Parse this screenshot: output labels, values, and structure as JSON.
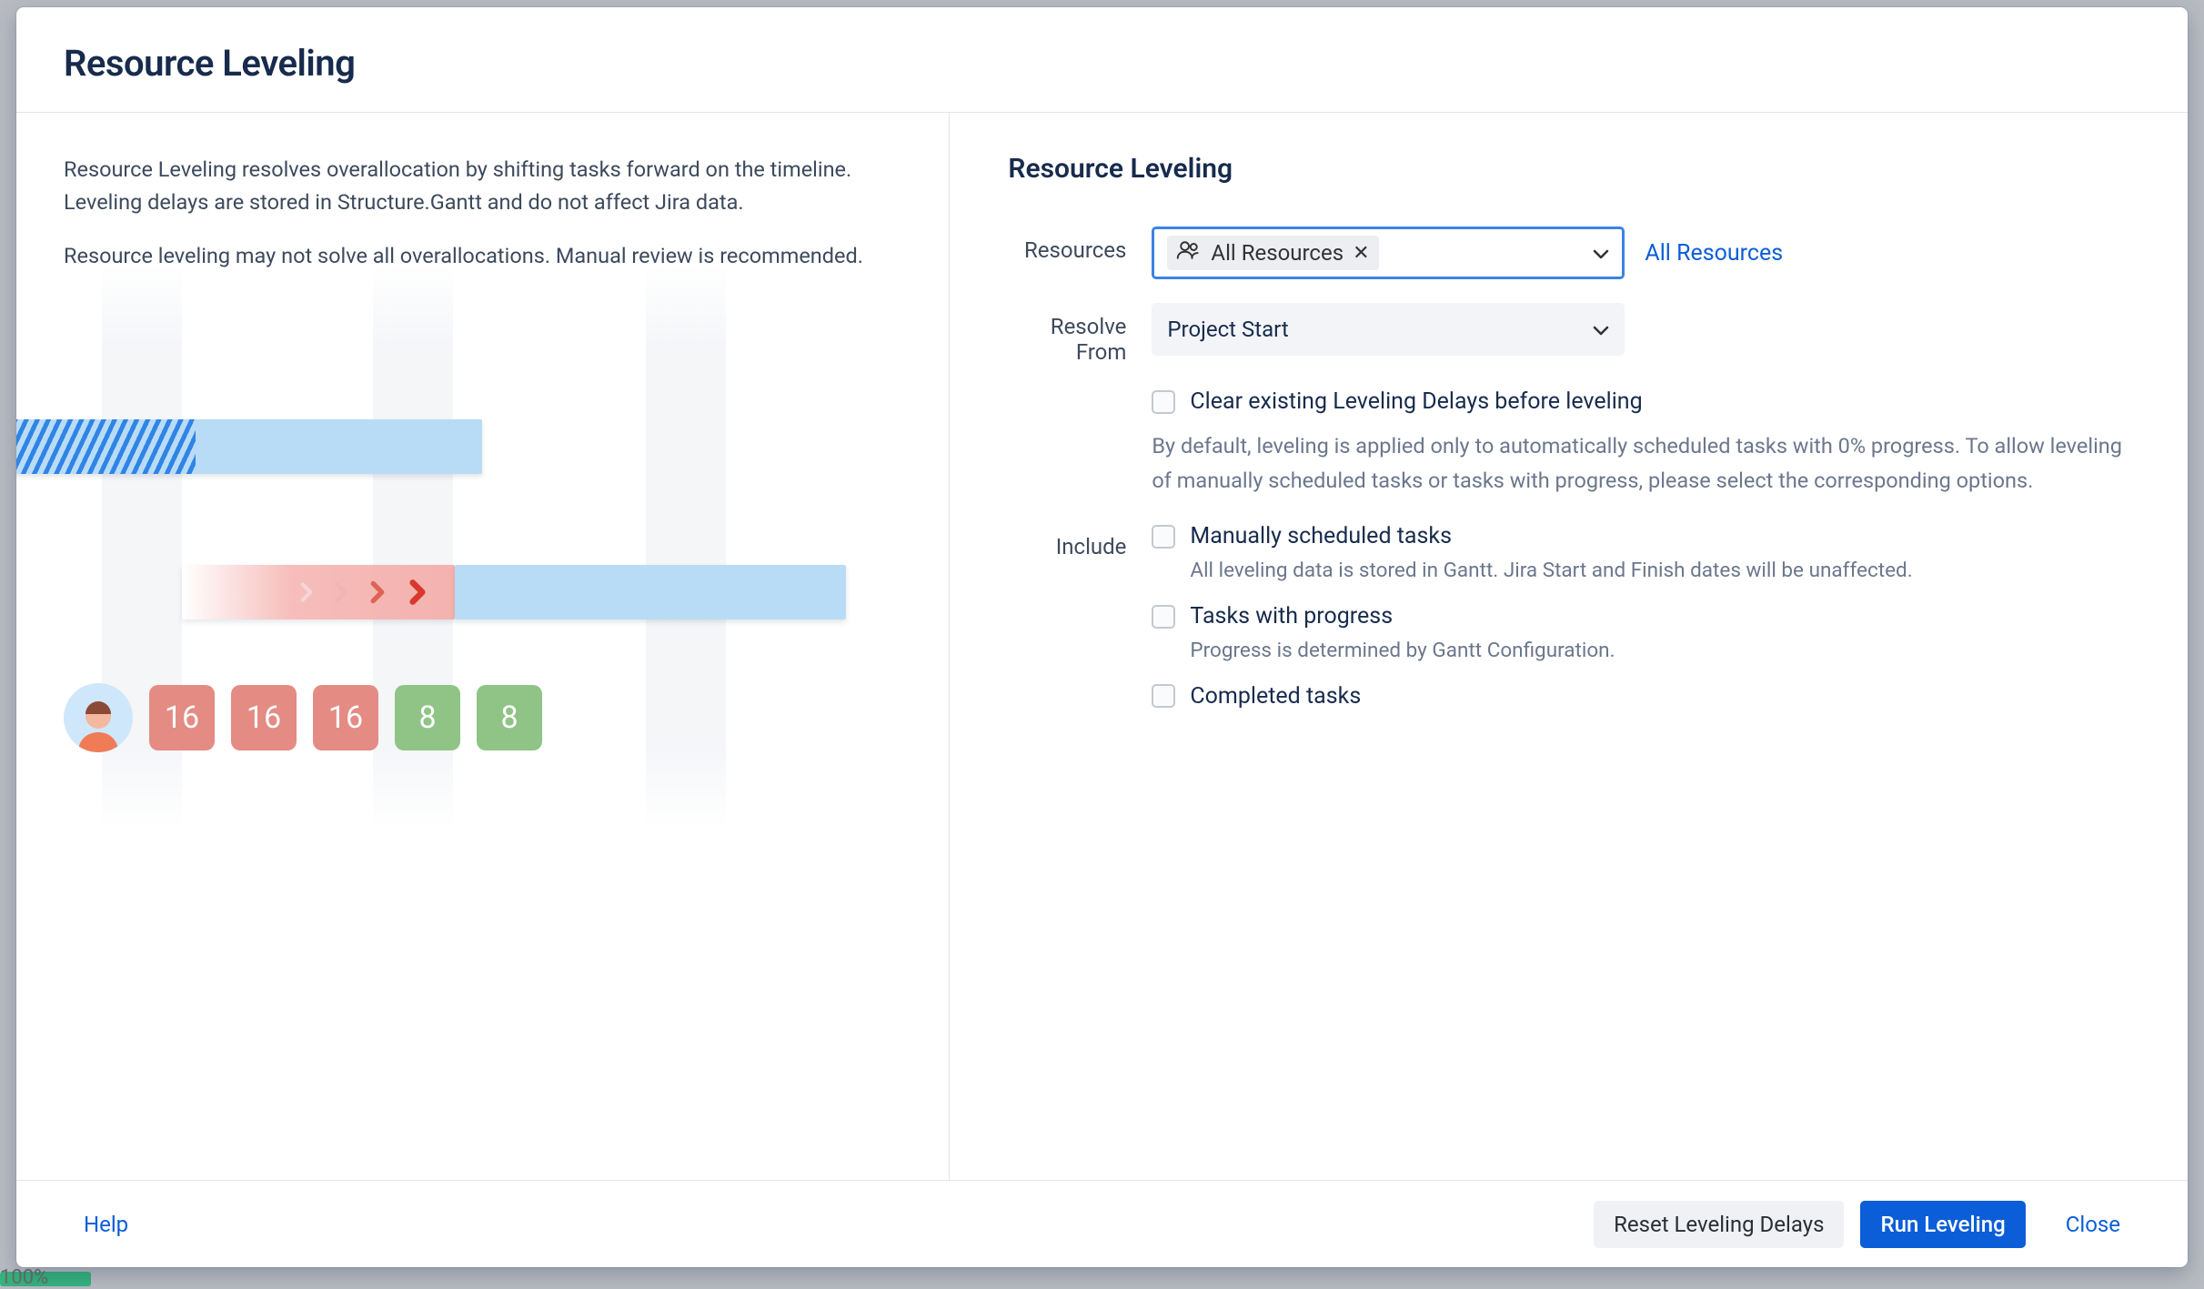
{
  "dialog": {
    "title": "Resource Leveling",
    "intro_p1": "Resource Leveling resolves overallocation by shifting tasks forward on the timeline. Leveling delays are stored in Structure.Gantt and do not affect Jira data.",
    "intro_p2": "Resource leveling may not solve all overallocations. Manual review is recommended."
  },
  "illustration": {
    "chips": [
      "16",
      "16",
      "16",
      "8",
      "8"
    ]
  },
  "form": {
    "heading": "Resource Leveling",
    "resources": {
      "label": "Resources",
      "tag_text": "All Resources",
      "all_link": "All Resources"
    },
    "resolve_from": {
      "label": "Resolve From",
      "value": "Project Start"
    },
    "clear_delays": {
      "label": "Clear existing Leveling Delays before leveling"
    },
    "default_note": "By default, leveling is applied only to automatically scheduled tasks with 0% progress. To allow leveling of manually scheduled tasks or tasks with progress, please select the corresponding options.",
    "include": {
      "label": "Include",
      "opt_manual": {
        "label": "Manually scheduled tasks",
        "help": "All leveling data is stored in Gantt. Jira Start and Finish dates will be unaffected."
      },
      "opt_progress": {
        "label": "Tasks with progress",
        "help": "Progress is determined by Gantt Configuration."
      },
      "opt_completed": {
        "label": "Completed tasks"
      }
    }
  },
  "footer": {
    "help": "Help",
    "reset": "Reset Leveling Delays",
    "run": "Run Leveling",
    "close": "Close"
  },
  "background": {
    "pct": "100%"
  }
}
